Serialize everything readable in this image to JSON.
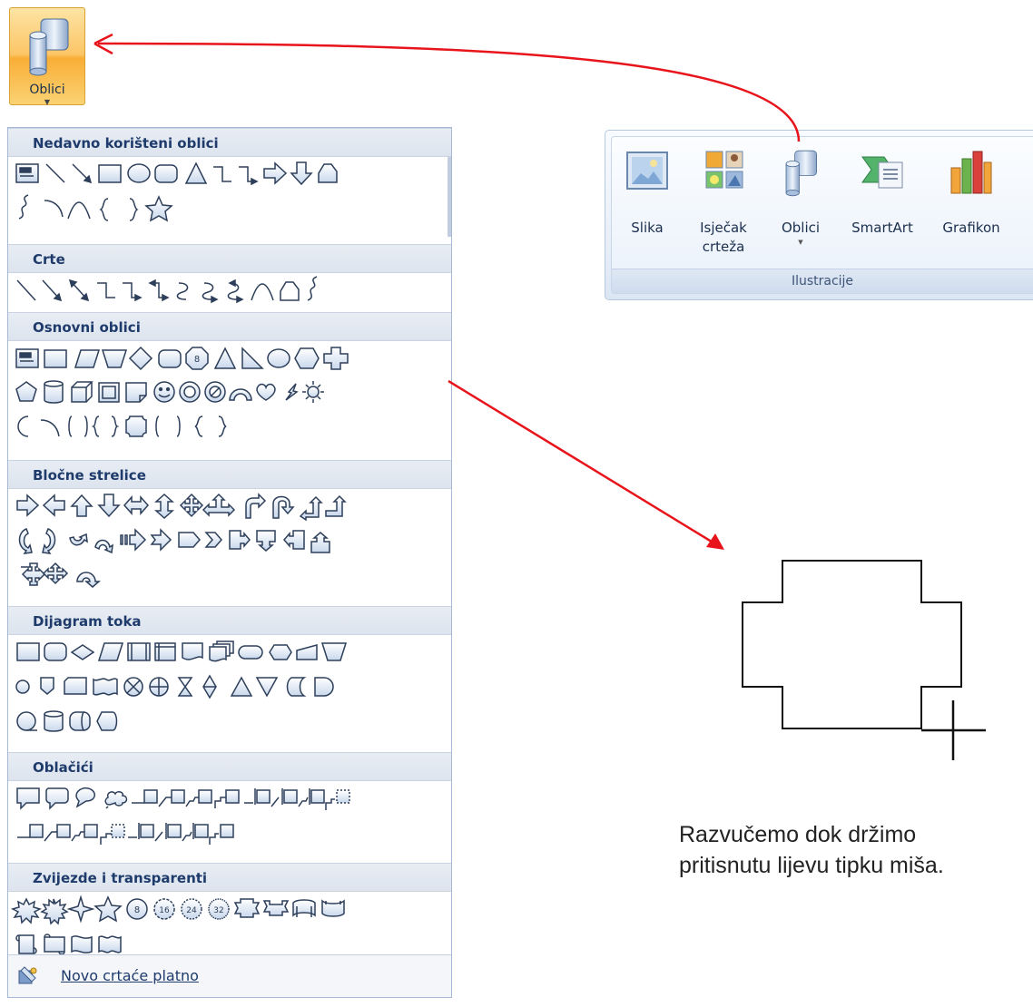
{
  "split_button": {
    "label": "Oblici"
  },
  "gallery": {
    "categories": [
      "Nedavno korišteni oblici",
      "Crte",
      "Osnovni oblici",
      "Bločne strelice",
      "Dijagram toka",
      "Oblačići",
      "Zvijezde i transparenti"
    ],
    "footer_label": "Novo crtaće platno"
  },
  "ribbon": {
    "buttons": [
      {
        "label": "Slika",
        "icon": "picture-icon"
      },
      {
        "label": "Isječak",
        "label2": "crteža",
        "icon": "clip-art-icon"
      },
      {
        "label": "Oblici",
        "icon": "shapes-icon"
      },
      {
        "label": "SmartArt",
        "icon": "smartart-icon"
      },
      {
        "label": "Grafikon",
        "icon": "chart-icon"
      }
    ],
    "group_label": "Ilustracije"
  },
  "instruction": {
    "line1": "Razvučemo dok držimo",
    "line2": "pritisnutu lijevu tipku miša."
  },
  "colors": {
    "accent_arrow": "#e8141b",
    "category_text": "#1e3b6b",
    "shape_stroke": "#2d3f5a"
  }
}
